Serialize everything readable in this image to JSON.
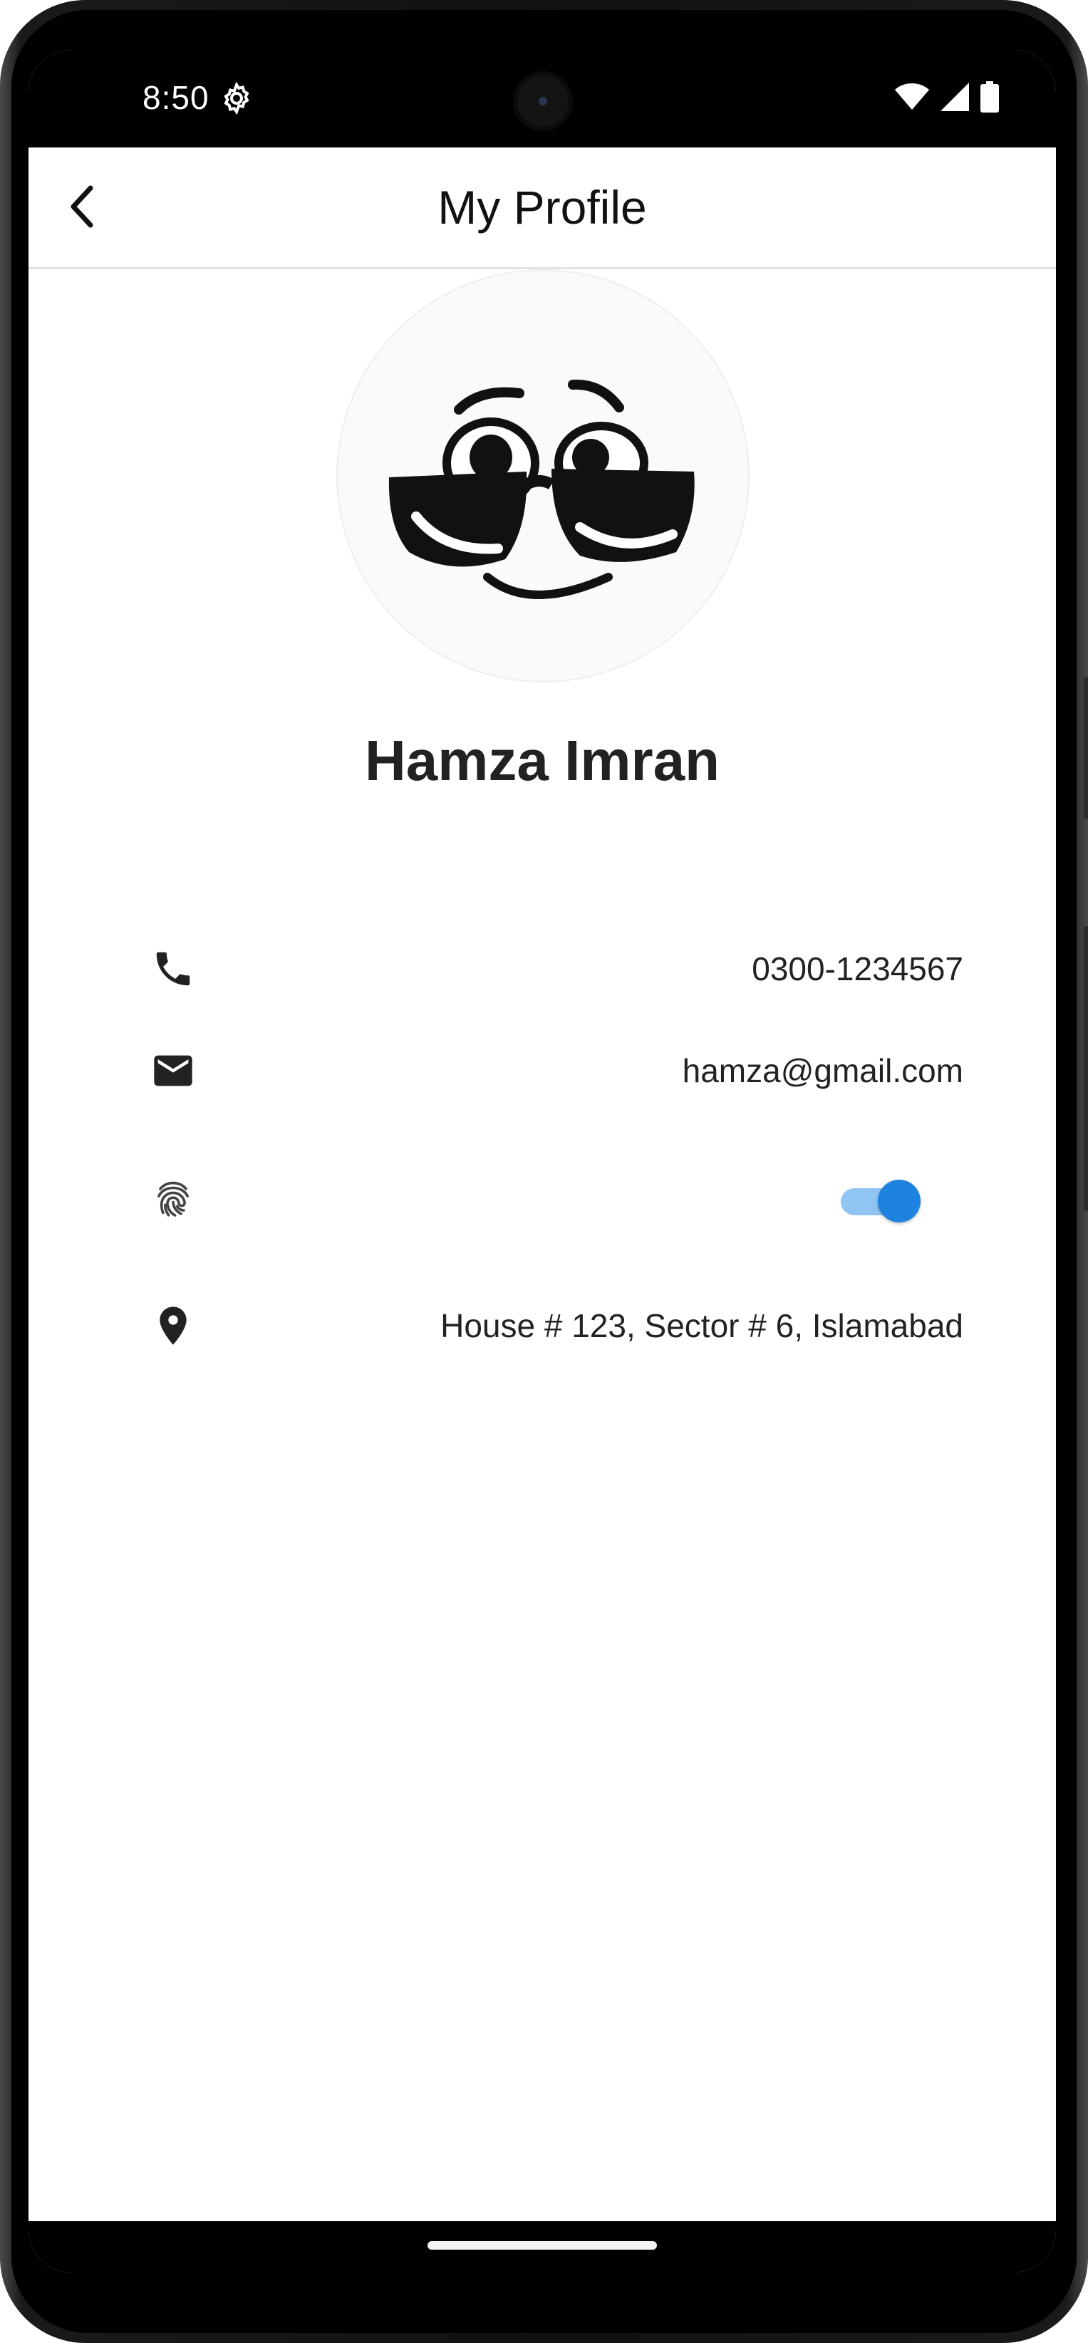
{
  "status_bar": {
    "time": "8:50",
    "icons": [
      "settings-icon",
      "wifi-icon",
      "signal-icon",
      "battery-icon"
    ]
  },
  "app_bar": {
    "title": "My Profile",
    "back_icon": "chevron-left-icon"
  },
  "profile": {
    "avatar_icon": "sunglasses-face-icon",
    "name": "Hamza Imran"
  },
  "details": {
    "phone": {
      "icon": "phone-icon",
      "value": "0300-1234567"
    },
    "email": {
      "icon": "email-icon",
      "value": "hamza@gmail.com"
    },
    "biometric": {
      "icon": "fingerprint-icon",
      "enabled": true
    },
    "address": {
      "icon": "location-pin-icon",
      "value": "House # 123, Sector # 6, Islamabad"
    }
  },
  "colors": {
    "accent": "#1e82e0",
    "accent_track": "#8fc4f3",
    "text": "#222222"
  }
}
